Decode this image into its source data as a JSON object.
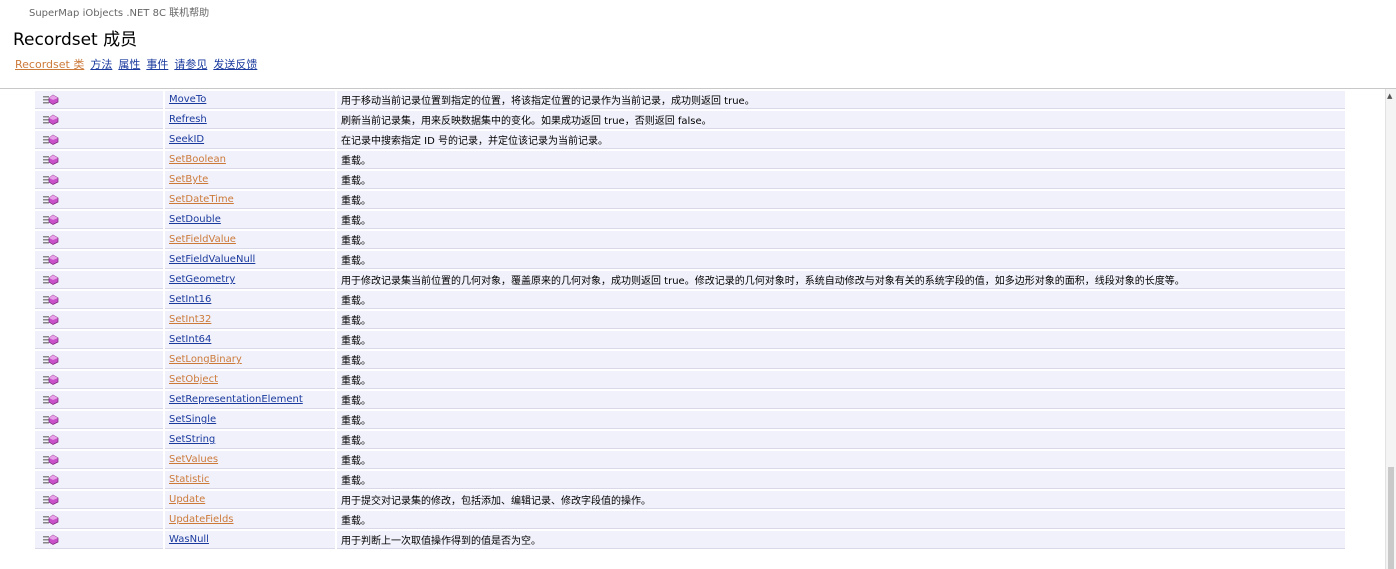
{
  "header": {
    "product": "SuperMap iObjects .NET 8C 联机帮助",
    "title": "Recordset 成员",
    "nav_links": [
      {
        "label": "Recordset 类",
        "visited": true
      },
      {
        "label": "方法",
        "visited": false
      },
      {
        "label": "属性",
        "visited": false
      },
      {
        "label": "事件",
        "visited": false
      },
      {
        "label": "请参见",
        "visited": false
      },
      {
        "label": "发送反馈",
        "visited": false
      }
    ]
  },
  "member_icon": "public-method-icon",
  "colors": {
    "link": "#1a3a9e",
    "visited": "#cc7a3a",
    "row_bg": "#f1f1fb"
  },
  "members": [
    {
      "name": "MoveTo",
      "visited": false,
      "desc": "用于移动当前记录位置到指定的位置，将该指定位置的记录作为当前记录，成功则返回 true。"
    },
    {
      "name": "Refresh",
      "visited": false,
      "desc": "刷新当前记录集，用来反映数据集中的变化。如果成功返回 true，否则返回 false。"
    },
    {
      "name": "SeekID",
      "visited": false,
      "desc": "在记录中搜索指定 ID 号的记录，并定位该记录为当前记录。"
    },
    {
      "name": "SetBoolean",
      "visited": true,
      "desc": "重载。"
    },
    {
      "name": "SetByte",
      "visited": true,
      "desc": "重载。"
    },
    {
      "name": "SetDateTime",
      "visited": true,
      "desc": "重载。"
    },
    {
      "name": "SetDouble",
      "visited": false,
      "desc": "重载。"
    },
    {
      "name": "SetFieldValue",
      "visited": true,
      "desc": "重载。"
    },
    {
      "name": "SetFieldValueNull",
      "visited": false,
      "desc": "重载。"
    },
    {
      "name": "SetGeometry",
      "visited": false,
      "desc": "用于修改记录集当前位置的几何对象，覆盖原来的几何对象，成功则返回 true。修改记录的几何对象时，系统自动修改与对象有关的系统字段的值，如多边形对象的面积，线段对象的长度等。"
    },
    {
      "name": "SetInt16",
      "visited": false,
      "desc": "重载。"
    },
    {
      "name": "SetInt32",
      "visited": true,
      "desc": "重载。"
    },
    {
      "name": "SetInt64",
      "visited": false,
      "desc": "重载。"
    },
    {
      "name": "SetLongBinary",
      "visited": true,
      "desc": "重载。"
    },
    {
      "name": "SetObject",
      "visited": true,
      "desc": "重载。"
    },
    {
      "name": "SetRepresentationElement",
      "visited": false,
      "desc": "重载。"
    },
    {
      "name": "SetSingle",
      "visited": false,
      "desc": "重载。"
    },
    {
      "name": "SetString",
      "visited": false,
      "desc": "重载。"
    },
    {
      "name": "SetValues",
      "visited": true,
      "desc": "重载。"
    },
    {
      "name": "Statistic",
      "visited": true,
      "desc": "重载。"
    },
    {
      "name": "Update",
      "visited": true,
      "desc": "用于提交对记录集的修改，包括添加、编辑记录、修改字段值的操作。"
    },
    {
      "name": "UpdateFields",
      "visited": true,
      "desc": "重载。"
    },
    {
      "name": "WasNull",
      "visited": false,
      "desc": "用于判断上一次取值操作得到的值是否为空。"
    }
  ]
}
